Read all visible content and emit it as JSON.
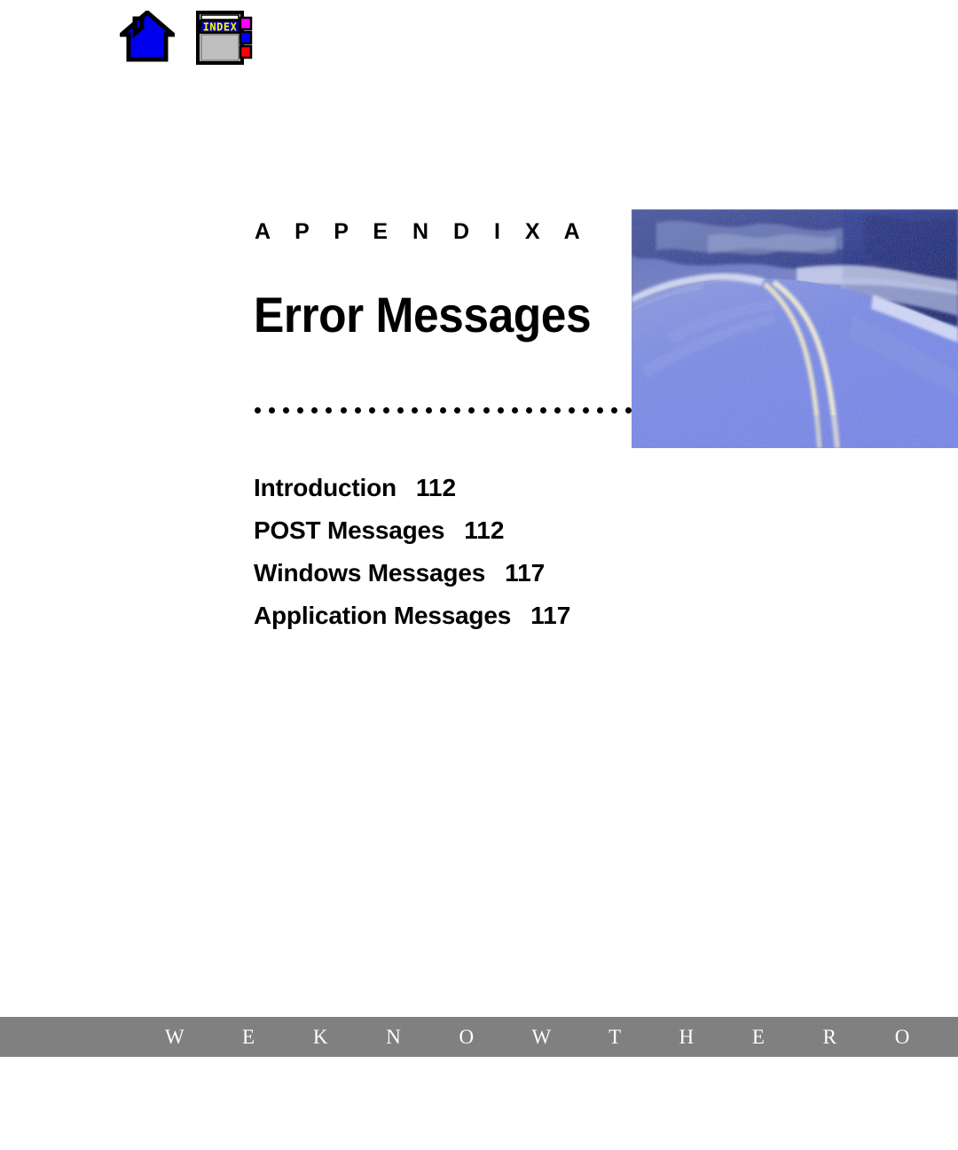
{
  "nav": {
    "home_icon": "home-icon",
    "index_icon": "index-icon",
    "index_label": "INDEX"
  },
  "header": {
    "appendix_label": "A P P E N D I X  A",
    "chapter_title": "Error Messages"
  },
  "hero": {
    "image_name": "curving-road-photo",
    "alt": "Blue-tinted photograph of a curving two-lane road"
  },
  "divider": {
    "name": "dotted-rule",
    "dot_count": 27
  },
  "toc": {
    "entries": [
      {
        "title": "Introduction",
        "page": "112"
      },
      {
        "title": "POST Messages",
        "page": "112"
      },
      {
        "title": "Windows Messages",
        "page": "117"
      },
      {
        "title": "Application Messages",
        "page": "117"
      }
    ]
  },
  "footer": {
    "tagline": "W E   K N O W   T H E   R O A D",
    "trademark": "™",
    "bar_color": "#808080"
  },
  "colors": {
    "page_background": "#ffffff",
    "text": "#000000",
    "home_icon_fill": "#0000ee",
    "index_titlebar": "#0000aa",
    "index_label_text": "#ffff00",
    "index_body": "#c0c0c0",
    "index_tab_magenta": "#ff00ff",
    "index_tab_blue": "#0000ff",
    "index_tab_red": "#ff0000",
    "footer_bar": "#808080",
    "footer_text": "#ffffff"
  }
}
